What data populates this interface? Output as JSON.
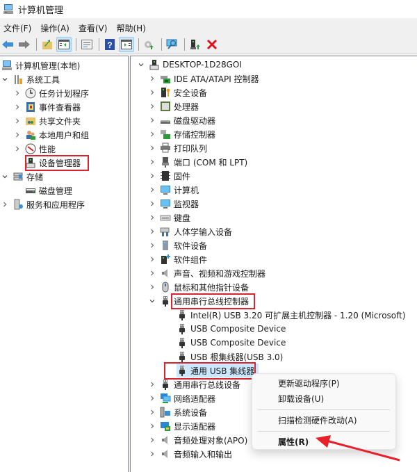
{
  "window": {
    "title": "计算机管理"
  },
  "menubar": [
    {
      "label": "文件(F)"
    },
    {
      "label": "操作(A)"
    },
    {
      "label": "查看(V)"
    },
    {
      "label": "帮助(H)"
    }
  ],
  "toolbar": [
    {
      "icon": "back-arrow-icon"
    },
    {
      "icon": "forward-arrow-icon"
    },
    {
      "icon": "up-folder-icon"
    },
    {
      "icon": "show-hide-console-tree-icon",
      "active": true
    },
    {
      "icon": "properties-icon"
    },
    {
      "icon": "help-icon"
    },
    {
      "icon": "show-hide-action-pane-icon",
      "active": true
    },
    {
      "icon": "update-driver-icon"
    },
    {
      "icon": "scan-hardware-icon"
    },
    {
      "icon": "enable-device-icon"
    },
    {
      "icon": "uninstall-device-icon"
    }
  ],
  "left_tree": [
    {
      "label": "计算机管理(本地)",
      "icon": "computer-management-icon",
      "level": 0,
      "expander": ""
    },
    {
      "label": "系统工具",
      "icon": "system-tools-icon",
      "level": 1,
      "expander": "expanded"
    },
    {
      "label": "任务计划程序",
      "icon": "task-scheduler-icon",
      "level": 2,
      "expander": "collapsed"
    },
    {
      "label": "事件查看器",
      "icon": "event-viewer-icon",
      "level": 2,
      "expander": "collapsed"
    },
    {
      "label": "共享文件夹",
      "icon": "shared-folders-icon",
      "level": 2,
      "expander": "collapsed"
    },
    {
      "label": "本地用户和组",
      "icon": "local-users-icon",
      "level": 2,
      "expander": "collapsed"
    },
    {
      "label": "性能",
      "icon": "performance-icon",
      "level": 2,
      "expander": "collapsed"
    },
    {
      "label": "设备管理器",
      "icon": "device-manager-icon",
      "level": 2,
      "expander": "",
      "highlighted": true
    },
    {
      "label": "存储",
      "icon": "storage-icon",
      "level": 1,
      "expander": "expanded"
    },
    {
      "label": "磁盘管理",
      "icon": "disk-management-icon",
      "level": 2,
      "expander": ""
    },
    {
      "label": "服务和应用程序",
      "icon": "services-apps-icon",
      "level": 1,
      "expander": "collapsed"
    }
  ],
  "device_tree": {
    "root": {
      "label": "DESKTOP-1D28GOI",
      "icon": "computer-root-icon",
      "expander": "expanded"
    },
    "categories": [
      {
        "label": "IDE ATA/ATAPI 控制器",
        "icon": "ide-controller-icon"
      },
      {
        "label": "安全设备",
        "icon": "security-device-icon"
      },
      {
        "label": "处理器",
        "icon": "processor-icon"
      },
      {
        "label": "磁盘驱动器",
        "icon": "disk-drive-icon"
      },
      {
        "label": "存储控制器",
        "icon": "storage-controller-icon"
      },
      {
        "label": "打印队列",
        "icon": "print-queue-icon"
      },
      {
        "label": "端口 (COM 和 LPT)",
        "icon": "port-icon"
      },
      {
        "label": "固件",
        "icon": "firmware-icon"
      },
      {
        "label": "计算机",
        "icon": "computer-icon"
      },
      {
        "label": "监视器",
        "icon": "monitor-icon"
      },
      {
        "label": "键盘",
        "icon": "keyboard-icon"
      },
      {
        "label": "人体学输入设备",
        "icon": "hid-icon"
      },
      {
        "label": "软件设备",
        "icon": "software-device-icon"
      },
      {
        "label": "软件组件",
        "icon": "software-component-icon"
      },
      {
        "label": "声音、视频和游戏控制器",
        "icon": "sound-icon"
      },
      {
        "label": "鼠标和其他指针设备",
        "icon": "mouse-icon"
      },
      {
        "label": "通用串行总线控制器",
        "icon": "usb-icon",
        "expanded": true,
        "highlighted": true,
        "children": [
          {
            "label": "Intel(R) USB 3.20 可扩展主机控制器 - 1.20 (Microsoft)",
            "icon": "usb-icon"
          },
          {
            "label": "USB Composite Device",
            "icon": "usb-icon"
          },
          {
            "label": "USB Composite Device",
            "icon": "usb-icon"
          },
          {
            "label": "USB 根集线器(USB 3.0)",
            "icon": "usb-icon"
          },
          {
            "label": "通用 USB 集线器",
            "icon": "usb-icon",
            "selected": true,
            "highlighted": true
          }
        ]
      },
      {
        "label": "通用串行总线设备",
        "icon": "usb-icon"
      },
      {
        "label": "网络适配器",
        "icon": "network-adapter-icon"
      },
      {
        "label": "系统设备",
        "icon": "system-device-icon"
      },
      {
        "label": "显示适配器",
        "icon": "display-adapter-icon"
      },
      {
        "label": "音频处理对象(APO)",
        "icon": "audio-apo-icon"
      },
      {
        "label": "音频输入和输出",
        "icon": "audio-io-icon"
      }
    ]
  },
  "context_menu": {
    "items": [
      {
        "label": "更新驱动程序(P)"
      },
      {
        "label": "卸载设备(U)"
      },
      {
        "separator": true
      },
      {
        "label": "扫描检测硬件改动(A)"
      },
      {
        "separator": true
      },
      {
        "label": "属性(R)",
        "bold": true
      }
    ]
  },
  "annotation": {
    "arrow_color": "#e8202a",
    "box_color": "#d9232e"
  }
}
